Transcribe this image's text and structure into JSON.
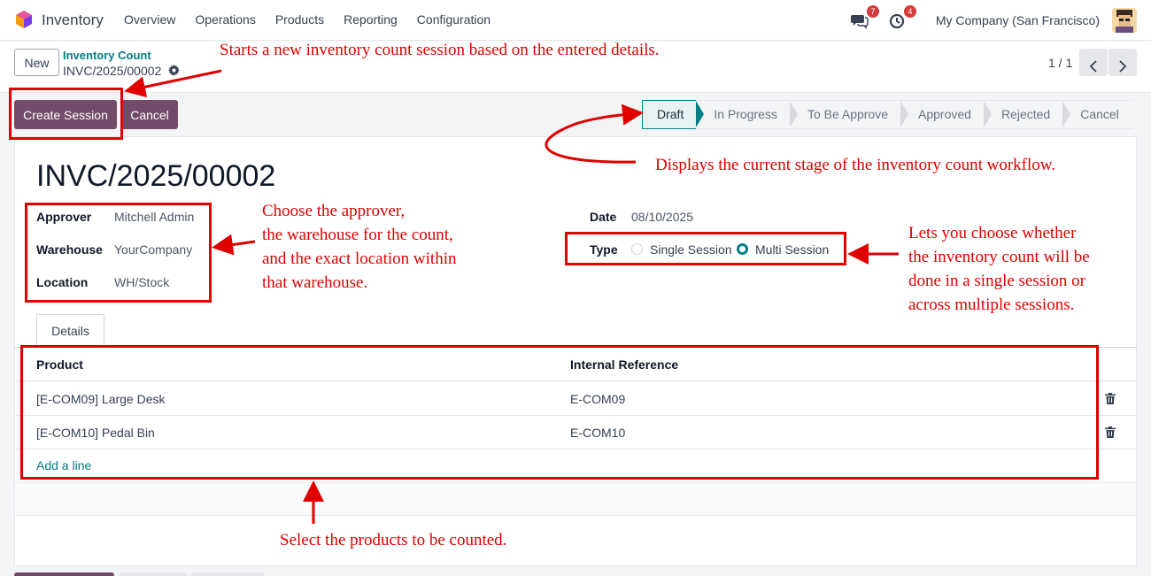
{
  "app": {
    "name": "Inventory",
    "colors": {
      "brand": "#714b67",
      "accent": "#017e84",
      "annotation": "#e00000"
    }
  },
  "nav": {
    "menu": [
      "Overview",
      "Operations",
      "Products",
      "Reporting",
      "Configuration"
    ]
  },
  "systray": {
    "messages_count": "7",
    "activities_count": "4",
    "company": "My Company (San Francisco)",
    "icons": [
      "chat-icon",
      "clock-icon",
      "avatar"
    ]
  },
  "control": {
    "new_label": "New",
    "breadcrumb_parent": "Inventory Count",
    "breadcrumb_current": "INVC/2025/00002",
    "pager": "1 / 1"
  },
  "actions": {
    "create_session": "Create Session",
    "cancel": "Cancel"
  },
  "statusbar": {
    "stages": [
      "Draft",
      "In Progress",
      "To Be Approve",
      "Approved",
      "Rejected",
      "Cancel"
    ],
    "active": "Draft"
  },
  "record": {
    "title": "INVC/2025/00002",
    "approver_label": "Approver",
    "approver": "Mitchell Admin",
    "warehouse_label": "Warehouse",
    "warehouse": "YourCompany",
    "location_label": "Location",
    "location": "WH/Stock",
    "date_label": "Date",
    "date": "08/10/2025",
    "type_label": "Type",
    "type_options": [
      "Single Session",
      "Multi Session"
    ],
    "type_selected": "Multi Session"
  },
  "tabs": {
    "details": "Details"
  },
  "table": {
    "headers": [
      "Product",
      "Internal Reference"
    ],
    "rows": [
      {
        "product": "[E-COM09] Large Desk",
        "ref": "E-COM09"
      },
      {
        "product": "[E-COM10] Pedal Bin",
        "ref": "E-COM10"
      }
    ],
    "add_line": "Add a line"
  },
  "annotations": {
    "create_session": "Starts a new inventory count session based on the entered details.",
    "statusbar": "Displays the current stage of the inventory count workflow.",
    "fields": "Choose the approver,\nthe warehouse for the count,\nand the exact location within\nthat warehouse.",
    "type": "Lets you choose whether\nthe inventory count will be\ndone in a single session or\nacross multiple sessions.",
    "products": "Select the products to be counted."
  }
}
